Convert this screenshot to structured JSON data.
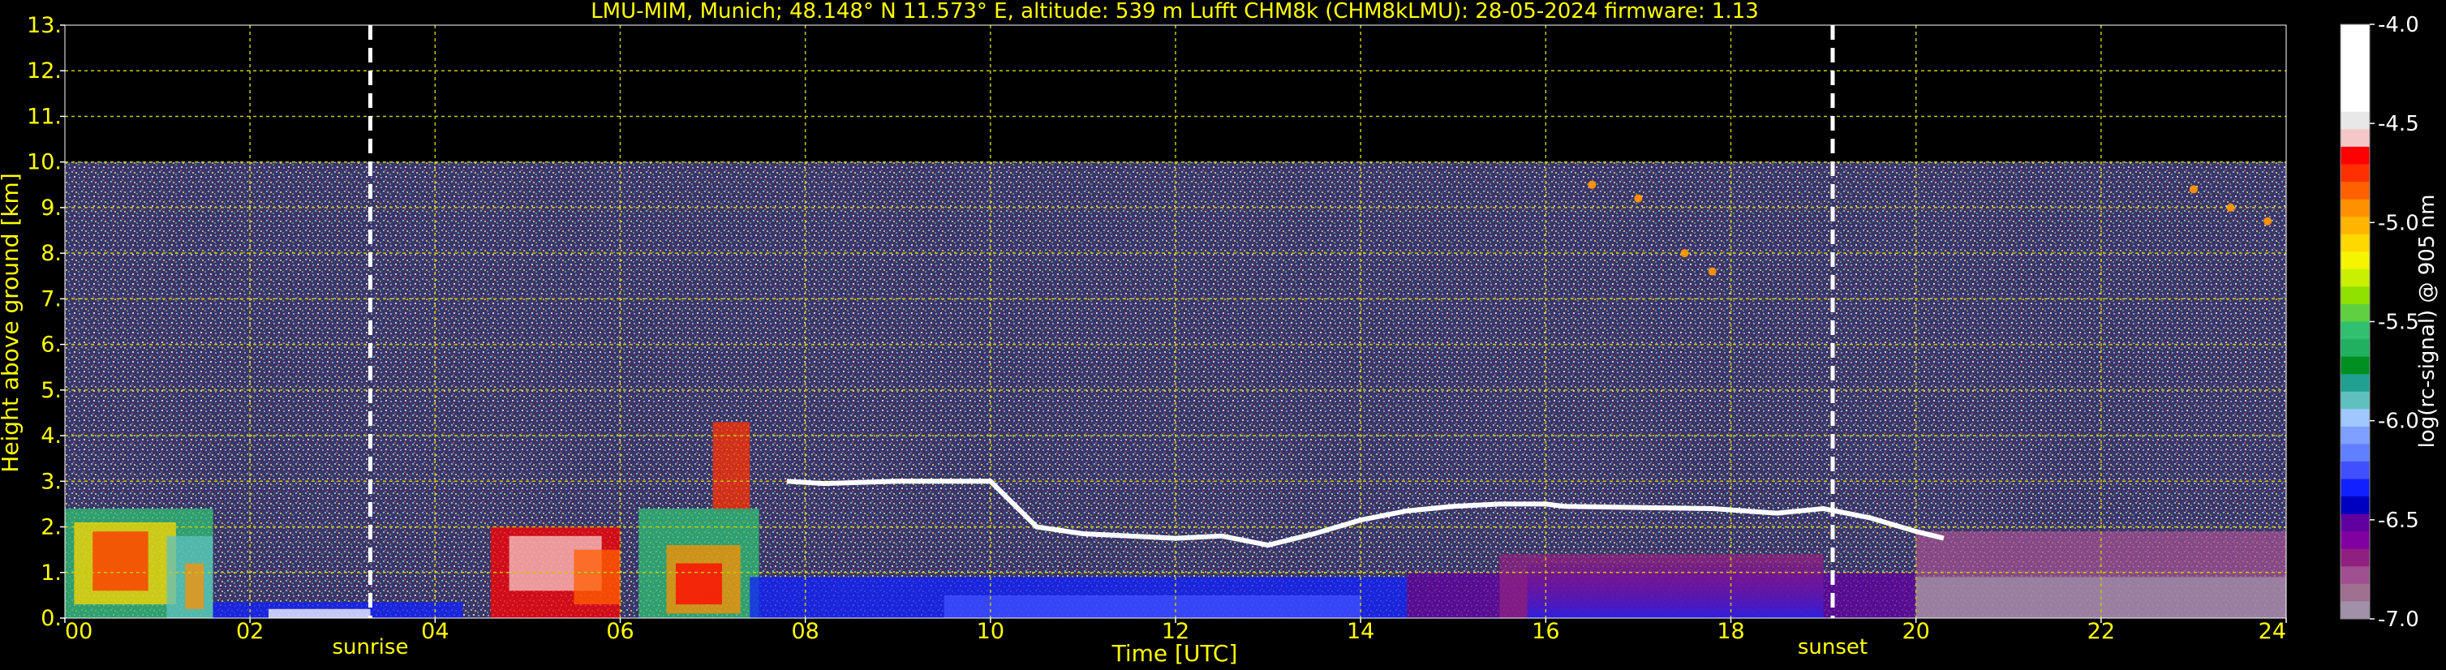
{
  "chart_data": {
    "type": "heatmap",
    "title": "LMU-MIM, Munich; 48.148° N 11.573° E, altitude: 539 m    Lufft CHM8k (CHM8kLMU): 28-05-2024    firmware: 1.13",
    "xlabel": "Time [UTC]",
    "ylabel": "Height above ground [km]",
    "xlim": [
      0,
      24
    ],
    "ylim": [
      0,
      13
    ],
    "x_ticks": [
      {
        "v": 0,
        "label": "00"
      },
      {
        "v": 2,
        "label": "02"
      },
      {
        "v": 4,
        "label": "04"
      },
      {
        "v": 6,
        "label": "06"
      },
      {
        "v": 8,
        "label": "08"
      },
      {
        "v": 10,
        "label": "10"
      },
      {
        "v": 12,
        "label": "12"
      },
      {
        "v": 14,
        "label": "14"
      },
      {
        "v": 16,
        "label": "16"
      },
      {
        "v": 18,
        "label": "18"
      },
      {
        "v": 20,
        "label": "20"
      },
      {
        "v": 22,
        "label": "22"
      },
      {
        "v": 24,
        "label": "24"
      }
    ],
    "y_ticks": [
      {
        "v": 0,
        "label": "0."
      },
      {
        "v": 1,
        "label": "1."
      },
      {
        "v": 2,
        "label": "2."
      },
      {
        "v": 3,
        "label": "3."
      },
      {
        "v": 4,
        "label": "4."
      },
      {
        "v": 5,
        "label": "5."
      },
      {
        "v": 6,
        "label": "6."
      },
      {
        "v": 7,
        "label": "7."
      },
      {
        "v": 8,
        "label": "8."
      },
      {
        "v": 9,
        "label": "9."
      },
      {
        "v": 10,
        "label": "10."
      },
      {
        "v": 11,
        "label": "11."
      },
      {
        "v": 12,
        "label": "12."
      },
      {
        "v": 13,
        "label": "13."
      }
    ],
    "data_top_km": 10,
    "markers": [
      {
        "label": "sunrise",
        "time": 3.3
      },
      {
        "label": "sunset",
        "time": 19.1
      }
    ],
    "cloud_layer": [
      [
        7.8,
        3.0
      ],
      [
        8.2,
        2.95
      ],
      [
        9.0,
        3.0
      ],
      [
        10.0,
        3.0
      ],
      [
        10.5,
        2.0
      ],
      [
        11.0,
        1.85
      ],
      [
        11.5,
        1.8
      ],
      [
        12.0,
        1.75
      ],
      [
        12.5,
        1.8
      ],
      [
        13.0,
        1.6
      ],
      [
        13.5,
        1.85
      ],
      [
        14.0,
        2.15
      ],
      [
        14.5,
        2.35
      ],
      [
        15.0,
        2.45
      ],
      [
        15.5,
        2.5
      ],
      [
        16.0,
        2.5
      ],
      [
        16.2,
        2.45
      ],
      [
        17.8,
        2.4
      ],
      [
        18.5,
        2.3
      ],
      [
        19.0,
        2.4
      ],
      [
        19.5,
        2.2
      ],
      [
        20.0,
        1.9
      ],
      [
        20.3,
        1.75
      ]
    ],
    "colorbar": {
      "label": "log(rc-signal) @ 905 nm",
      "range": [
        -7.0,
        -4.0
      ],
      "ticks": [
        {
          "v": -4.0,
          "label": "-4.0"
        },
        {
          "v": -4.5,
          "label": "-4.5"
        },
        {
          "v": -5.0,
          "label": "-5.0"
        },
        {
          "v": -5.5,
          "label": "-5.5"
        },
        {
          "v": -6.0,
          "label": "-6.0"
        },
        {
          "v": -6.5,
          "label": "-6.5"
        },
        {
          "v": -7.0,
          "label": "-7.0"
        }
      ],
      "colors_top_to_bottom": [
        "#ffffff",
        "#ffffff",
        "#ffffff",
        "#ffffff",
        "#ffffff",
        "#e8e8e8",
        "#f5c8c8",
        "#ff0000",
        "#ff3000",
        "#ff6000",
        "#ff9000",
        "#ffb400",
        "#ffd800",
        "#f5f500",
        "#c8f000",
        "#90e000",
        "#60d040",
        "#30c070",
        "#20b060",
        "#008f20",
        "#20a090",
        "#60c0c0",
        "#a0c8ff",
        "#80a0ff",
        "#6080ff",
        "#4050ff",
        "#1020ff",
        "#0000c0",
        "#6000a0",
        "#8000a0",
        "#902080",
        "#a05090",
        "#a07090",
        "#a090a8"
      ]
    },
    "colors": {
      "axis_text": "#ffff00",
      "grid": "#c8c800",
      "background": "#000000",
      "noise_bg": "#4a4478",
      "marker_line": "#ffffff"
    }
  }
}
